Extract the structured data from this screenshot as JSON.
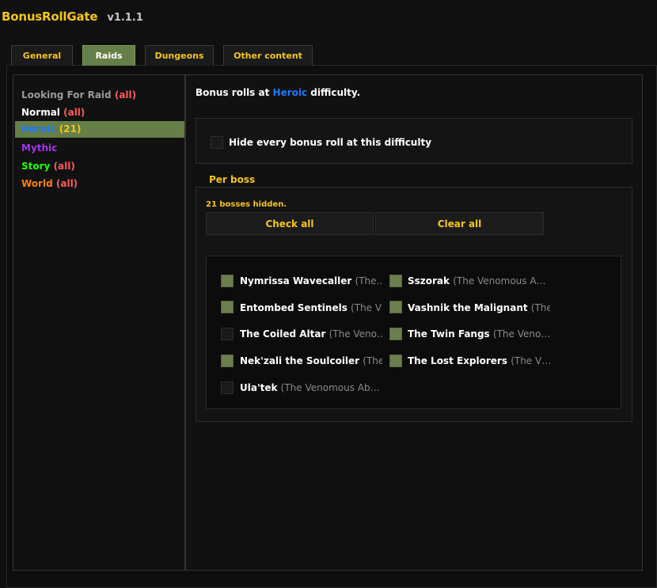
{
  "app": {
    "title": "BonusRollGate",
    "version": "v1.1.1"
  },
  "tabs": [
    {
      "label": "General"
    },
    {
      "label": "Raids"
    },
    {
      "label": "Dungeons"
    },
    {
      "label": "Other content"
    }
  ],
  "sidebar": {
    "items": [
      {
        "label": "Looking For Raid",
        "count": "(all)"
      },
      {
        "label": "Normal",
        "count": "(all)"
      },
      {
        "label": "Heroic",
        "count": "(21)"
      },
      {
        "label": "Mythic",
        "count": ""
      },
      {
        "label": "Story",
        "count": "(all)"
      },
      {
        "label": "World",
        "count": "(all)"
      }
    ]
  },
  "main": {
    "intro_prefix": "Bonus rolls at",
    "intro_difficulty": "Heroic",
    "intro_suffix": "difficulty.",
    "hide_label": "Hide every bonus roll at this difficulty",
    "per_boss_title": "Per boss",
    "hidden_count": "21 bosses hidden.",
    "check_all": "Check all",
    "clear_all": "Clear all"
  },
  "bosses": [
    {
      "name": "Nymrissa Wavecaller",
      "inst": "(The…",
      "checked": true
    },
    {
      "name": "Sszorak",
      "inst": "(The Venomous A…",
      "checked": true
    },
    {
      "name": "Entombed Sentinels",
      "inst": "(The V…",
      "checked": true
    },
    {
      "name": "Vashnik the Malignant",
      "inst": "(The…",
      "checked": true
    },
    {
      "name": "The Coiled Altar",
      "inst": "(The Veno…",
      "checked": false
    },
    {
      "name": "The Twin Fangs",
      "inst": "(The Veno…",
      "checked": true
    },
    {
      "name": "Nek'zali the Soulcoiler",
      "inst": "(The…",
      "checked": true
    },
    {
      "name": "The Lost Explorers",
      "inst": "(The V…",
      "checked": true
    },
    {
      "name": "Ula'tek",
      "inst": "(The Venomous Ab…",
      "checked": false
    }
  ],
  "colors": {
    "accent_gold": "#f5c518",
    "selected_green": "#667e47",
    "heroic_blue": "#1e78ff",
    "mythic_purple": "#a335ee",
    "story_green": "#1eff00",
    "world_orange": "#ff8000",
    "all_red": "#ff5a5a"
  }
}
